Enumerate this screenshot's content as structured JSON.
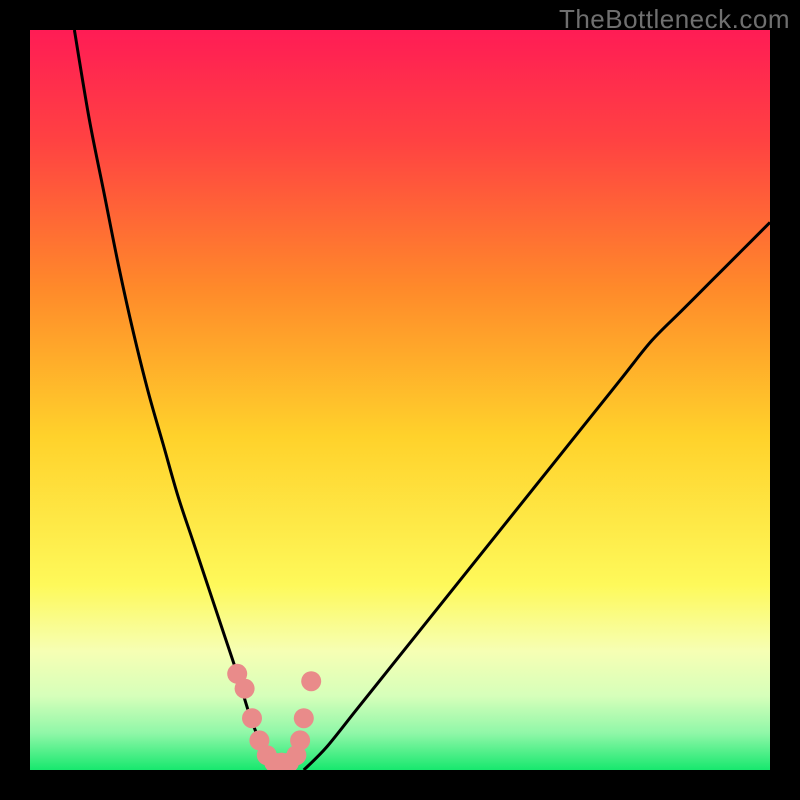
{
  "watermark": "TheBottleneck.com",
  "chart_data": {
    "type": "line",
    "title": "",
    "xlabel": "",
    "ylabel": "",
    "xlim": [
      0,
      100
    ],
    "ylim": [
      0,
      100
    ],
    "series": [
      {
        "name": "left-curve",
        "x": [
          6,
          8,
          10,
          12,
          14,
          16,
          18,
          20,
          22,
          24,
          26,
          28,
          29.5,
          31,
          33
        ],
        "values": [
          100,
          88,
          78,
          68,
          59,
          51,
          44,
          37,
          31,
          25,
          19,
          13,
          8,
          4,
          0
        ]
      },
      {
        "name": "right-curve",
        "x": [
          37,
          40,
          44,
          48,
          52,
          56,
          60,
          64,
          68,
          72,
          76,
          80,
          84,
          88,
          92,
          96,
          100
        ],
        "values": [
          0,
          3,
          8,
          13,
          18,
          23,
          28,
          33,
          38,
          43,
          48,
          53,
          58,
          62,
          66,
          70,
          74
        ]
      },
      {
        "name": "pink-markers",
        "x": [
          28,
          29,
          30,
          31,
          32,
          33,
          34,
          35,
          36,
          36.5,
          37,
          38
        ],
        "values": [
          13,
          11,
          7,
          4,
          2,
          1,
          1,
          1,
          2,
          4,
          7,
          12
        ]
      }
    ],
    "gradient_stops": [
      {
        "pct": 0,
        "color": "#ff1c55"
      },
      {
        "pct": 15,
        "color": "#ff4242"
      },
      {
        "pct": 35,
        "color": "#ff8a2a"
      },
      {
        "pct": 55,
        "color": "#ffd22b"
      },
      {
        "pct": 75,
        "color": "#fef95a"
      },
      {
        "pct": 84,
        "color": "#f6ffb4"
      },
      {
        "pct": 90,
        "color": "#d6ffba"
      },
      {
        "pct": 95,
        "color": "#90f7a8"
      },
      {
        "pct": 100,
        "color": "#17e86e"
      }
    ],
    "curve_stroke": "#000000",
    "marker_fill": "#e98b8a",
    "marker_radius_px": 10
  }
}
